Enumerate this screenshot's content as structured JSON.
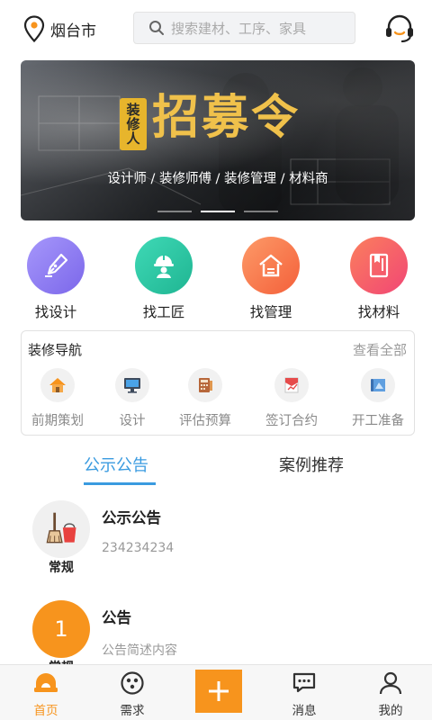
{
  "header": {
    "city": "烟台市",
    "search_placeholder": "搜索建材、工序、家具",
    "location_icon": "location-pin-icon",
    "service_icon": "headset-icon"
  },
  "banner": {
    "badge": "装修人",
    "title": "招募令",
    "subtitle": "设计师 / 装修师傅 / 装修管理 / 材料商",
    "slides": 3,
    "active_slide": 2
  },
  "quick_entries": [
    {
      "label": "找设计",
      "icon": "pen-nib-icon",
      "color": "#8f7cf2"
    },
    {
      "label": "找工匠",
      "icon": "worker-helmet-icon",
      "color": "#2bc7a6"
    },
    {
      "label": "找管理",
      "icon": "house-icon",
      "color": "#f97a4f"
    },
    {
      "label": "找材料",
      "icon": "material-book-icon",
      "color": "#f5566f"
    }
  ],
  "guide": {
    "title": "装修导航",
    "view_all": "查看全部",
    "items": [
      {
        "label": "前期策划",
        "icon": "house-icon"
      },
      {
        "label": "设计",
        "icon": "monitor-icon"
      },
      {
        "label": "评估预算",
        "icon": "calculator-icon"
      },
      {
        "label": "签订合约",
        "icon": "contract-icon"
      },
      {
        "label": "开工准备",
        "icon": "blueprint-icon"
      }
    ]
  },
  "tabs": [
    {
      "label": "公示公告",
      "active": true
    },
    {
      "label": "案例推荐",
      "active": false
    }
  ],
  "notices": [
    {
      "tag": "常规",
      "title": "公示公告",
      "desc": "234234234",
      "avatar_icon": "broom-bucket-icon"
    },
    {
      "tag": "常规",
      "title": "公告",
      "desc": "公告简述内容",
      "avatar_text": "1"
    }
  ],
  "bottom_nav": [
    {
      "label": "首页",
      "icon": "home-icon",
      "active": true
    },
    {
      "label": "需求",
      "icon": "demand-icon",
      "active": false
    },
    {
      "label": "",
      "icon": "plus-icon",
      "active": false
    },
    {
      "label": "消息",
      "icon": "message-icon",
      "active": false
    },
    {
      "label": "我的",
      "icon": "user-icon",
      "active": false
    }
  ],
  "colors": {
    "accent": "#f7941d",
    "tab_active": "#3a9be0",
    "banner_text": "#f0c14b"
  }
}
